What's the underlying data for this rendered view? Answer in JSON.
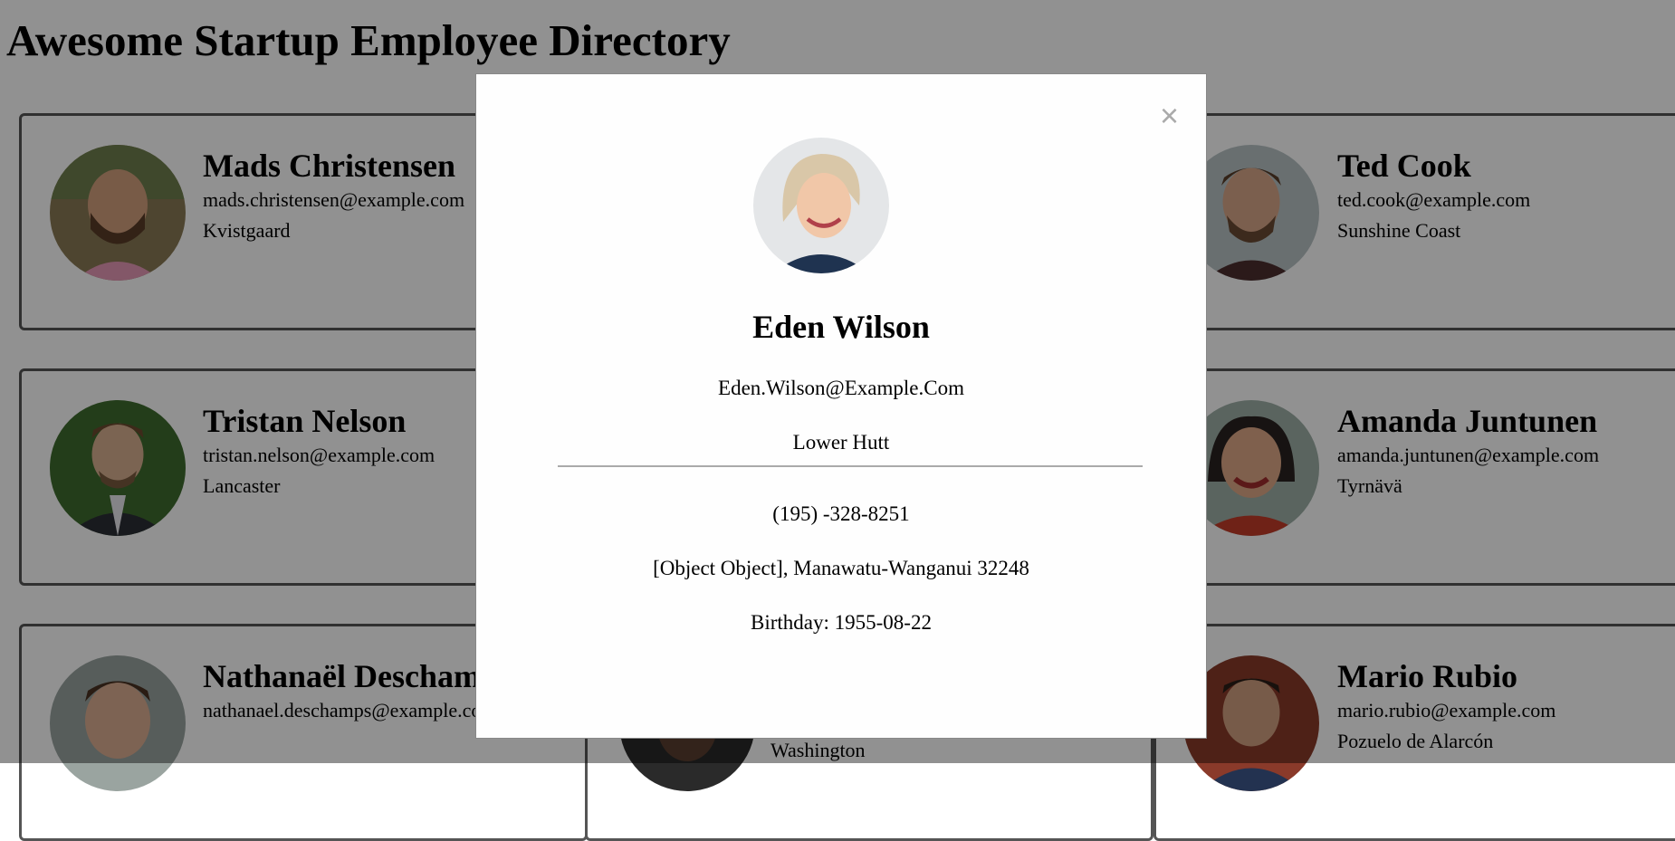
{
  "page": {
    "title": "Awesome Startup Employee Directory"
  },
  "employees": [
    {
      "name": "Mads Christensen",
      "email": "mads.christensen@example.com",
      "city": "Kvistgaard"
    },
    {
      "name": "",
      "email": "",
      "city": ""
    },
    {
      "name": "Ted Cook",
      "email": "ted.cook@example.com",
      "city": "Sunshine Coast"
    },
    {
      "name": "Tristan Nelson",
      "email": "tristan.nelson@example.com",
      "city": "Lancaster"
    },
    {
      "name": "",
      "email": "",
      "city": ""
    },
    {
      "name": "Amanda Juntunen",
      "email": "amanda.juntunen@example.com",
      "city": "Tyrnävä"
    },
    {
      "name": "Nathanaël Deschamps",
      "email": "nathanael.deschamps@example.com",
      "city": ""
    },
    {
      "name": "",
      "email": "",
      "city": "Washington"
    },
    {
      "name": "Mario Rubio",
      "email": "mario.rubio@example.com",
      "city": "Pozuelo de Alarcón"
    }
  ],
  "modal": {
    "close_label": "×",
    "name": "Eden Wilson",
    "email": "Eden.Wilson@Example.Com",
    "city": "Lower Hutt",
    "phone": "(195) -328-8251",
    "address": "[Object Object], Manawatu-Wanganui 32248",
    "birthday": "Birthday: 1955-08-22"
  },
  "icons": {
    "close": "close-icon"
  },
  "colors": {
    "card_border": "#555555",
    "overlay": "rgba(0,0,0,0.43)",
    "divider": "#aaaaaa",
    "close": "#aaaaaa"
  }
}
